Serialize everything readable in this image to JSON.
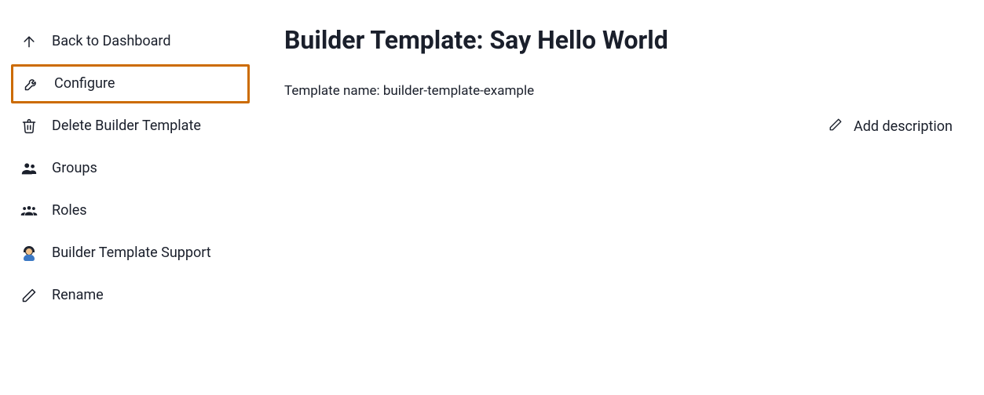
{
  "sidebar": {
    "items": [
      {
        "label": "Back to Dashboard"
      },
      {
        "label": "Configure"
      },
      {
        "label": "Delete Builder Template"
      },
      {
        "label": "Groups"
      },
      {
        "label": "Roles"
      },
      {
        "label": "Builder Template Support"
      },
      {
        "label": "Rename"
      }
    ]
  },
  "main": {
    "title": "Builder Template: Say Hello World",
    "template_name_label": "Template name: ",
    "template_name_value": "builder-template-example",
    "add_description_label": "Add description"
  }
}
